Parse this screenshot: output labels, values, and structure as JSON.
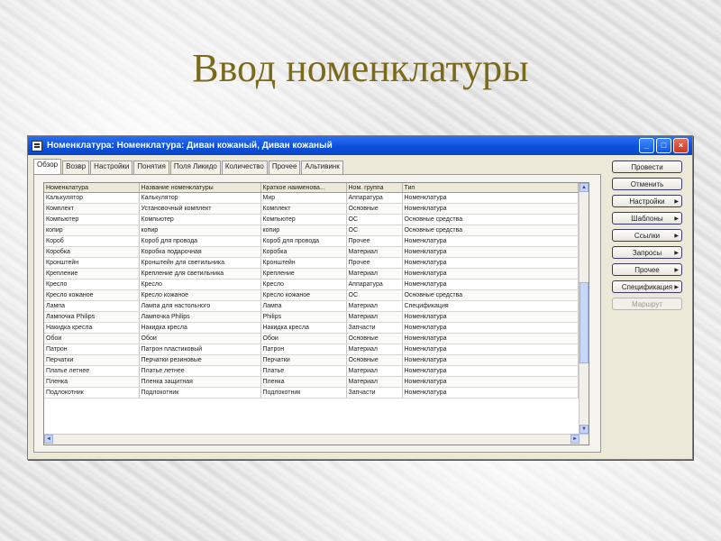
{
  "slide": {
    "title": "Ввод номенклатуры"
  },
  "window": {
    "title": "Номенклатура: Номенклатура: Диван кожаный, Диван кожаный",
    "minimize": "_",
    "maximize": "□",
    "close": "×"
  },
  "tabs": [
    "Обзор",
    "Возвр",
    "Настройки",
    "Понятия",
    "Поля Ликидо",
    "Количество",
    "Прочее",
    "Альтивинк"
  ],
  "grid": {
    "columns": [
      "Номенклатура",
      "Название номенклатуры",
      "Краткое наименова...",
      "Ном. группа",
      "Тип"
    ],
    "rows": [
      [
        "Калькулятор",
        "Калькулятор",
        "Мир",
        "Аппаратура",
        "Номенклатура"
      ],
      [
        "Комплект",
        "Установочный комплект",
        "Комплект",
        "Основные",
        "Номенклатура"
      ],
      [
        "Компьютер",
        "Компьютер",
        "Компьютер",
        "ОС",
        "Основные средства"
      ],
      [
        "копир",
        "копир",
        "копир",
        "ОС",
        "Основные средства"
      ],
      [
        "Короб",
        "Короб для провода",
        "Короб для провода",
        "Прочее",
        "Номенклатура"
      ],
      [
        "Коробка",
        "Коробка подарочная",
        "Коробка",
        "Материал",
        "Номенклатура"
      ],
      [
        "Кронштейн",
        "Кронштейн для светильника",
        "Кронштейн",
        "Прочее",
        "Номенклатура"
      ],
      [
        "Крепление",
        "Крепление для светильника",
        "Крепление",
        "Материал",
        "Номенклатура"
      ],
      [
        "Кресло",
        "Кресло",
        "Кресло",
        "Аппаратура",
        "Номенклатура"
      ],
      [
        "Кресло кожаное",
        "Кресло кожаное",
        "Кресло кожаное",
        "ОС",
        "Основные средства"
      ],
      [
        "Лампа",
        "Лампа для настольного",
        "Лампа",
        "Материал",
        "Спецификация"
      ],
      [
        "Лампочка Philips",
        "Лампочка Philips",
        "Philips",
        "Материал",
        "Номенклатура"
      ],
      [
        "Накидка кресла",
        "Накидка кресла",
        "Накидка кресла",
        "Запчасти",
        "Номенклатура"
      ],
      [
        "Обои",
        "Обои",
        "Обои",
        "Основные",
        "Номенклатура"
      ],
      [
        "Патрон",
        "Патрон пластиковый",
        "Патрон",
        "Материал",
        "Номенклатура"
      ],
      [
        "Перчатки",
        "Перчатки резиновые",
        "Перчатки",
        "Основные",
        "Номенклатура"
      ],
      [
        "Платье летнее",
        "Платье летнее",
        "Платье",
        "Материал",
        "Номенклатура"
      ],
      [
        "Пленка",
        "Пленка защитная",
        "Пленка",
        "Материал",
        "Номенклатура"
      ],
      [
        "Подлокотник",
        "Подлокотник",
        "Подлокотник",
        "Запчасти",
        "Номенклатура"
      ]
    ]
  },
  "buttons": [
    {
      "label": "Провести",
      "arrow": false,
      "enabled": true
    },
    {
      "label": "Отменить",
      "arrow": false,
      "enabled": true
    },
    {
      "label": "Настройки",
      "arrow": true,
      "enabled": true
    },
    {
      "label": "Шаблоны",
      "arrow": true,
      "enabled": true
    },
    {
      "label": "Ссылки",
      "arrow": true,
      "enabled": true
    },
    {
      "label": "Запросы",
      "arrow": true,
      "enabled": true
    },
    {
      "label": "Прочее",
      "arrow": true,
      "enabled": true
    },
    {
      "label": "Спецификация",
      "arrow": true,
      "enabled": true
    },
    {
      "label": "Маршрут",
      "arrow": false,
      "enabled": false
    }
  ],
  "scroll": {
    "up": "▲",
    "down": "▼",
    "left": "◄",
    "right": "►"
  },
  "colors": {
    "title": "#7a6a1a",
    "titlebar": "#0b4fd9"
  }
}
